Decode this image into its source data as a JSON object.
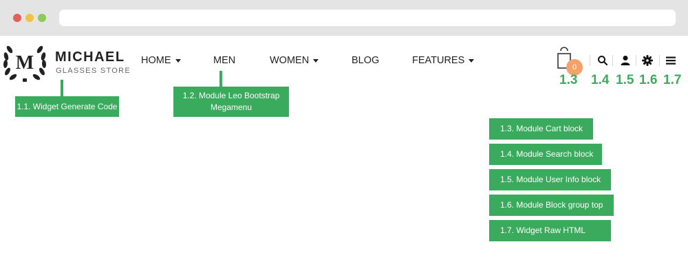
{
  "logo": {
    "letter": "M",
    "name": "MICHAEL",
    "subtitle": "GLASSES STORE"
  },
  "nav": {
    "items": [
      {
        "label": "HOME",
        "dropdown": true
      },
      {
        "label": "MEN",
        "dropdown": false
      },
      {
        "label": "WOMEN",
        "dropdown": true
      },
      {
        "label": "BLOG",
        "dropdown": false
      },
      {
        "label": "FEATURES",
        "dropdown": true
      }
    ]
  },
  "cart": {
    "count": "0"
  },
  "icons": [
    "cart-icon",
    "search-icon",
    "user-icon",
    "gear-icon",
    "menu-icon"
  ],
  "numbers": {
    "n13": "1.3",
    "n14": "1.4",
    "n15": "1.5",
    "n16": "1.6",
    "n17": "1.7"
  },
  "annotations": {
    "a11": "1.1. Widget Generate Code",
    "a12_line1": "1.2. Module Leo Bootstrap",
    "a12_line2": "Megamenu",
    "a13": "1.3. Module Cart block",
    "a14": "1.4. Module Search block",
    "a15": "1.5. Module User Info block",
    "a16": "1.6. Module Block group top",
    "a17": "1.7. Widget Raw HTML"
  },
  "colors": {
    "annotation_green": "#3aab5c",
    "number_green": "#3dab5c",
    "cart_badge": "#f4a26a",
    "browser_chrome": "#e4e4e4"
  }
}
